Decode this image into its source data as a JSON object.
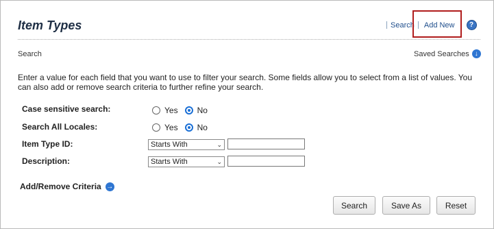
{
  "page": {
    "title": "Item Types",
    "links": {
      "search": "Search",
      "add_new": "Add New"
    },
    "help_icon_glyph": "?",
    "section_label": "Search",
    "saved_searches": "Saved Searches",
    "description": "Enter a value for each field that you want to use to filter your search. Some fields allow you to select from a list of values. You can also add or remove search criteria to further refine your search."
  },
  "form": {
    "case_sensitive": {
      "label": "Case sensitive search:",
      "yes": "Yes",
      "no": "No",
      "selected": "No"
    },
    "all_locales": {
      "label": "Search All Locales:",
      "yes": "Yes",
      "no": "No",
      "selected": "No"
    },
    "item_type_id": {
      "label": "Item Type ID:",
      "operator": "Starts With",
      "value": ""
    },
    "description": {
      "label": "Description:",
      "operator": "Starts With",
      "value": ""
    }
  },
  "criteria_link": "Add/Remove Criteria",
  "buttons": {
    "search": "Search",
    "save_as": "Save As",
    "reset": "Reset"
  },
  "colors": {
    "highlight_box": "#b01c1c",
    "link": "#1f4e8c",
    "accent_icon": "#2f76d2"
  },
  "icons": {
    "help": "help-icon",
    "saved_searches": "arrow-down-circle-icon",
    "criteria": "arrow-right-circle-icon"
  }
}
